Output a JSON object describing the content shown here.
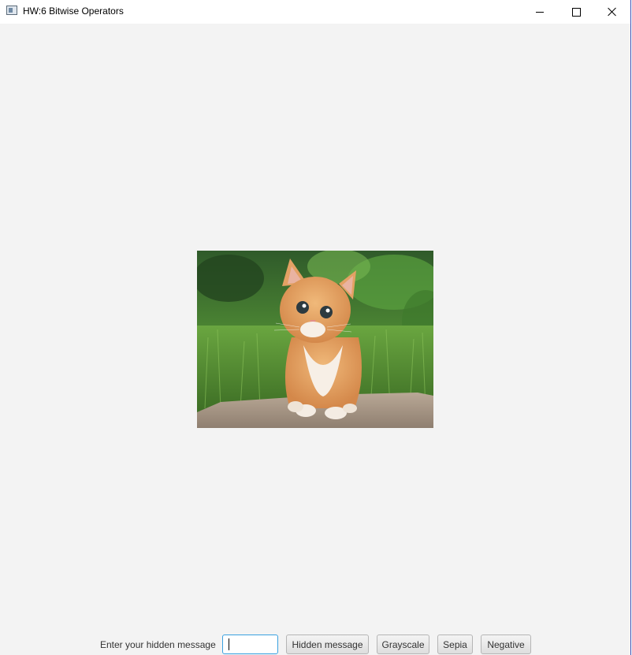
{
  "window": {
    "title": "HW:6 Bitwise Operators",
    "icon": "app-window-icon",
    "controls": {
      "minimize_icon": "minimize-icon",
      "maximize_icon": "maximize-icon",
      "close_icon": "close-icon"
    }
  },
  "image": {
    "subject": "orange-tabby-kitten-photo"
  },
  "controls": {
    "prompt_label": "Enter your hidden message",
    "message_input": {
      "value": "",
      "placeholder": ""
    },
    "buttons": {
      "hidden_message": "Hidden message",
      "grayscale": "Grayscale",
      "sepia": "Sepia",
      "negative": "Negative"
    }
  },
  "colors": {
    "background": "#f3f3f3",
    "titlebar": "#ffffff",
    "input_focus_border": "#3aa1e0"
  }
}
